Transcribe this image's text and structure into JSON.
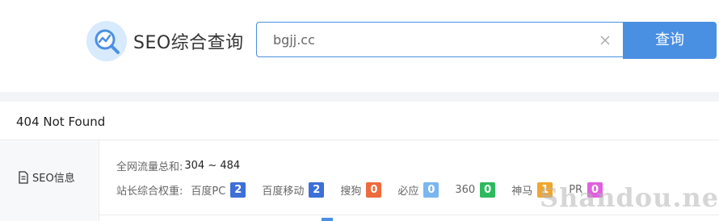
{
  "header": {
    "site_title": "SEO综合查询",
    "search": {
      "value": "bgjj.cc",
      "placeholder": ""
    },
    "search_button_label": "查询"
  },
  "status": {
    "message": "404 Not Found"
  },
  "seo": {
    "section_label": "SEO信息",
    "traffic": {
      "label": "全网流量总和:",
      "value": "304 ~ 484"
    },
    "weights": {
      "label": "站长综合权重:",
      "items": [
        {
          "label": "百度PC",
          "value": "2",
          "color": "#3c6fd8"
        },
        {
          "label": "百度移动",
          "value": "2",
          "color": "#3c6fd8"
        },
        {
          "label": "搜狗",
          "value": "0",
          "color": "#ef6a3c"
        },
        {
          "label": "必应",
          "value": "0",
          "color": "#7ab6ef"
        },
        {
          "label": "360",
          "value": "0",
          "color": "#2dba5e"
        },
        {
          "label": "神马",
          "value": "1",
          "color": "#f0a62c"
        },
        {
          "label": "PR",
          "value": "0",
          "color": "#e060e0"
        }
      ]
    }
  },
  "watermark": "Shandou.net",
  "icons": {
    "logo": "chart-magnifier-icon",
    "clear": "close-icon",
    "doc": "document-icon"
  },
  "colors": {
    "accent": "#4a90e2",
    "page_gap": "#f2f4f7",
    "logo_bg": "#d8eafd"
  }
}
